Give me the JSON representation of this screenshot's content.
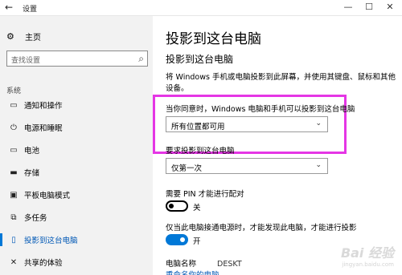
{
  "window": {
    "title": "设置",
    "back_glyph": "←",
    "minimize_glyph": "—",
    "maximize_glyph": "☐",
    "close_glyph": "✕"
  },
  "sidebar": {
    "home": {
      "label": "主页",
      "icon": "gear-icon",
      "glyph": "⚙"
    },
    "search": {
      "placeholder": "查找设置",
      "icon": "search-icon",
      "glyph": "⌕"
    },
    "section_label": "系统",
    "items": [
      {
        "label": "通知和操作",
        "icon": "notification-icon",
        "glyph": "▭",
        "active": false
      },
      {
        "label": "电源和睡眠",
        "icon": "power-icon",
        "glyph": "⏻",
        "active": false
      },
      {
        "label": "电池",
        "icon": "battery-icon",
        "glyph": "▭",
        "active": false
      },
      {
        "label": "存储",
        "icon": "storage-icon",
        "glyph": "▬",
        "active": false
      },
      {
        "label": "平板电脑模式",
        "icon": "tablet-mode-icon",
        "glyph": "▣",
        "active": false
      },
      {
        "label": "多任务",
        "icon": "multitasking-icon",
        "glyph": "⧉",
        "active": false
      },
      {
        "label": "投影到这台电脑",
        "icon": "project-icon",
        "glyph": "▯",
        "active": true
      },
      {
        "label": "共享的体验",
        "icon": "shared-experiences-icon",
        "glyph": "✕",
        "active": false
      }
    ]
  },
  "main": {
    "title": "投影到这台电脑",
    "subtitle": "投影到这台电脑",
    "description": "将 Windows 手机或电脑投影到此屏幕，并使用其键盘、鼠标和其他设备。",
    "setting1": {
      "label": "当你同意时，Windows 电脑和手机可以投影到这台电脑",
      "value": "所有位置都可用"
    },
    "setting2": {
      "label": "要求投影到这台电脑",
      "value": "仅第一次"
    },
    "pin": {
      "label": "需要 PIN 才能进行配对",
      "state": "关",
      "on": false
    },
    "power": {
      "label": "仅当此电脑接通电源时，才能发现此电脑，才能进行投影",
      "state": "开",
      "on": true
    },
    "pc_name": {
      "label": "电脑名称",
      "value": "DESKT"
    },
    "rename_link": "重命名你的电脑"
  },
  "colors": {
    "accent": "#0078d7",
    "highlight": "#e536e5",
    "sidebar_bg": "#f2f2f2"
  }
}
